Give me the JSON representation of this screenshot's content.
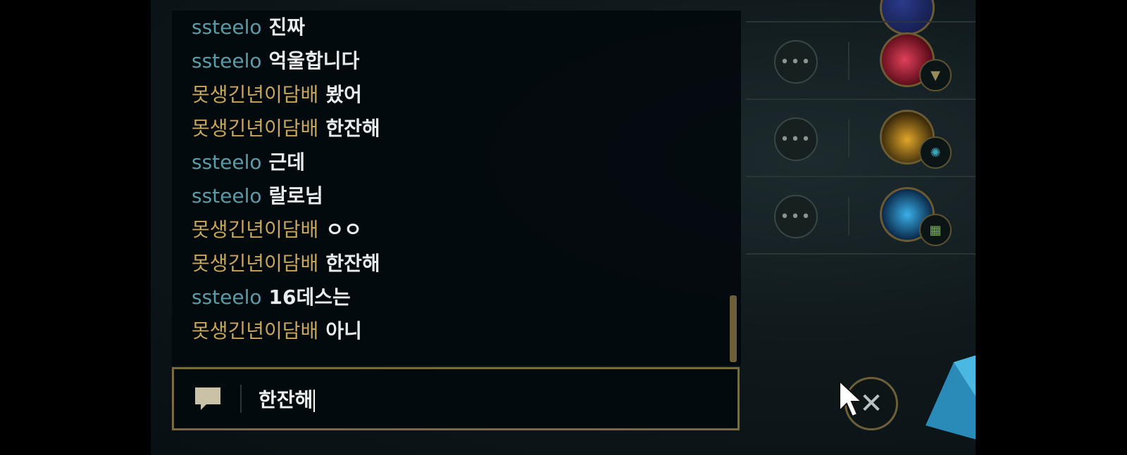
{
  "chat": {
    "messages": [
      {
        "name": "ssteelo",
        "text": "진짜",
        "team": "teal"
      },
      {
        "name": "ssteelo",
        "text": "억울합니다",
        "team": "teal"
      },
      {
        "name": "못생긴년이담배",
        "text": "봤어",
        "team": "gold"
      },
      {
        "name": "못생긴년이담배",
        "text": "한잔해",
        "team": "gold"
      },
      {
        "name": "ssteelo",
        "text": "근데",
        "team": "teal"
      },
      {
        "name": "ssteelo",
        "text": "랄로님",
        "team": "teal"
      },
      {
        "name": "못생긴년이담배",
        "text": "ㅇㅇ",
        "team": "gold"
      },
      {
        "name": "못생긴년이담배",
        "text": "한잔해",
        "team": "gold"
      },
      {
        "name": "ssteelo",
        "text": "16데스는",
        "team": "teal"
      },
      {
        "name": "못생긴년이담배",
        "text": "아니",
        "team": "gold"
      }
    ],
    "input_value": "한잔해"
  },
  "roster": {
    "more_label": "•••"
  },
  "icons": {
    "chat_icon": "speech-bubble-icon",
    "close_icon": "close-icon",
    "more_icon": "more-options-icon"
  },
  "colors": {
    "teal_name": "#5a9ba8",
    "gold_name": "#c8a55a",
    "accent_gold": "#7a6a3c"
  }
}
